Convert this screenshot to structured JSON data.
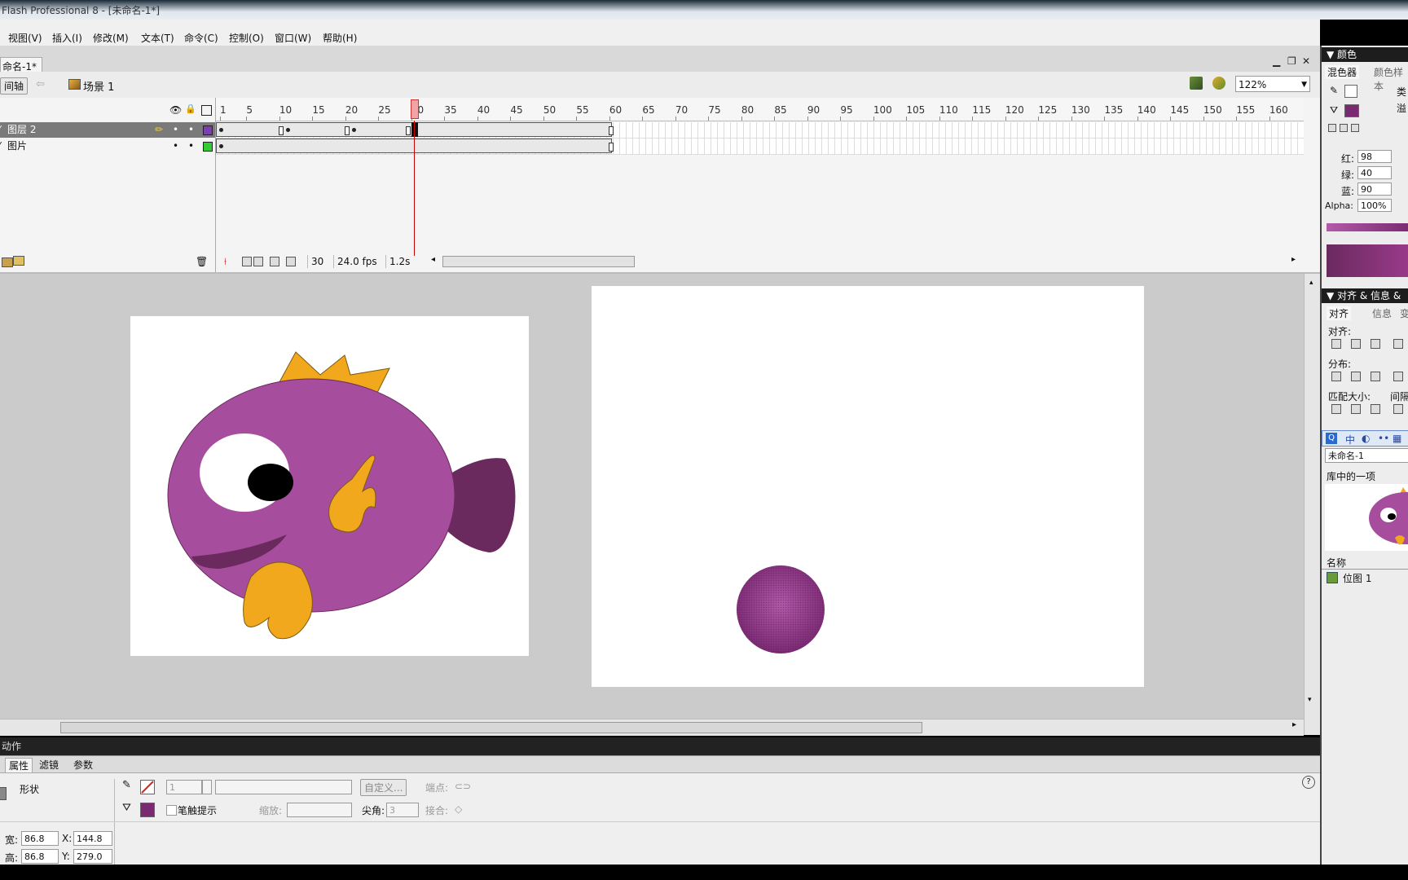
{
  "window": {
    "title": "Flash Professional 8 - [未命名-1*]"
  },
  "menubar": [
    "视图(V)",
    "插入(I)",
    "修改(M)",
    "文本(T)",
    "命令(C)",
    "控制(O)",
    "窗口(W)",
    "帮助(H)"
  ],
  "document": {
    "tab": "命名-1*",
    "win_minimize": "▁",
    "win_restore": "❐",
    "win_close": "✕",
    "timeline_button": "间轴",
    "back_arrow": "⇦",
    "scene": "场景 1",
    "zoom": "122%"
  },
  "timeline": {
    "ruler_labels": [
      "1",
      "5",
      "10",
      "15",
      "20",
      "25",
      "30",
      "35",
      "40",
      "45",
      "50",
      "55",
      "60",
      "65",
      "70",
      "75",
      "80",
      "85",
      "90",
      "95",
      "100",
      "105",
      "110",
      "115",
      "120",
      "125",
      "130",
      "135",
      "140",
      "145",
      "150",
      "155",
      "160"
    ],
    "layers": [
      {
        "name": "图层 2",
        "pencil": "✏",
        "dot1": "•",
        "dot2": "•",
        "color": "#7b3fb0"
      },
      {
        "name": "图片",
        "pencil": "",
        "dot1": "•",
        "dot2": "•",
        "color": "#33cc33"
      }
    ],
    "header_icons": {
      "eye": "👁",
      "lock": "🔒"
    },
    "current_frame": "30",
    "fps": "24.0 fps",
    "elapsed": "1.2s",
    "trash_icon": "🗑"
  },
  "properties": {
    "tabs": [
      "属性",
      "滤镜",
      "参数"
    ],
    "actions_label": "动作",
    "selection_type": "形状",
    "stroke_height": "1",
    "custom_button": "自定义...",
    "endpoint_label": "端点:",
    "stroke_hint_label": "笔触提示",
    "scale_label": "缩放:",
    "miter_label": "尖角:",
    "miter_value": "3",
    "join_label": "接合:",
    "width_label": "宽:",
    "width_value": "86.8",
    "height_label": "高:",
    "height_value": "86.8",
    "x_label": "X:",
    "x_value": "144.8",
    "y_label": "Y:",
    "y_value": "279.0",
    "help_icon": "?"
  },
  "color_panel": {
    "title": "▼ 颜色",
    "tabs": [
      "混色器",
      "颜色样本"
    ],
    "type_label": "类",
    "overflow_label": "溢",
    "red_label": "红:",
    "red_value": "98",
    "green_label": "绿:",
    "green_value": "40",
    "blue_label": "蓝:",
    "blue_value": "90",
    "alpha_label": "Alpha:",
    "alpha_value": "100%",
    "fill_color": "#7a2a72"
  },
  "align_panel": {
    "title": "▼ 对齐 & 信息 &",
    "tabs": [
      "对齐",
      "信息",
      "变"
    ],
    "align_label": "对齐:",
    "distribute_label": "分布:",
    "match_size_label": "匹配大小:",
    "spacing_label": "间隔"
  },
  "library_panel": {
    "toolbar": [
      "Q",
      "中",
      "◐",
      "••",
      "▦"
    ],
    "doc_name": "未命名-1",
    "count_label": "库中的一项",
    "name_header": "名称",
    "items": [
      "位图 1"
    ]
  }
}
